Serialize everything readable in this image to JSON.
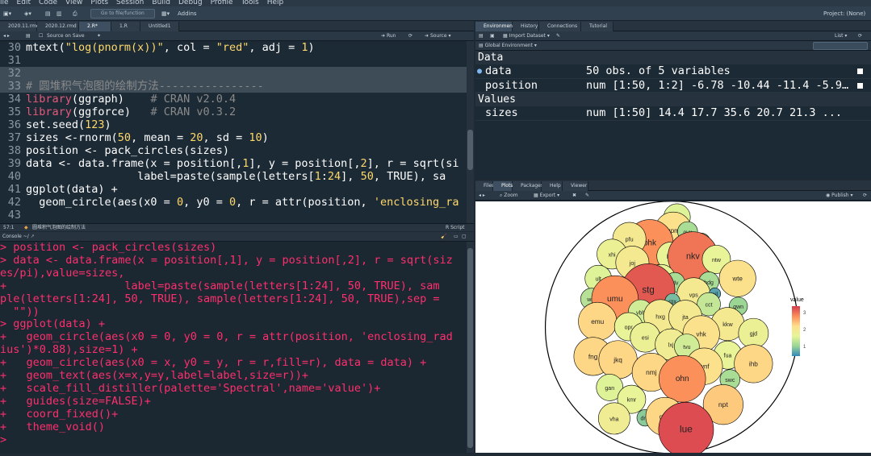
{
  "menu": [
    "ile",
    "Edit",
    "Code",
    "View",
    "Plots",
    "Session",
    "Build",
    "Debug",
    "Profile",
    "Tools",
    "Help"
  ],
  "toolbar": {
    "goto_placeholder": "Go to file/function",
    "addins": "Addins",
    "project": "Project: (None)"
  },
  "source_tabs": [
    "2020.11.rmd",
    "2020.12.rmd",
    "2.R*",
    "1.R",
    "Untitled1"
  ],
  "source_toolbar": {
    "source_on_save": "Source on Save",
    "run": "Run",
    "source": "Source"
  },
  "code_lines": [
    {
      "n": "30",
      "html": "mtext(<span class='str'>\"log(pnorm(x))\"</span>, col = <span class='str'>\"red\"</span>, adj = <span class='num'>1</span>)"
    },
    {
      "n": "31",
      "html": ""
    },
    {
      "n": "32",
      "html": "",
      "hl": true
    },
    {
      "n": "33",
      "html": "<span class='cmt'># 圆堆积气泡图的绘制方法----------------</span>",
      "hl": true
    },
    {
      "n": "34",
      "html": "<span class='kw'>library</span>(ggraph)    <span class='cmt'># CRAN v2.0.4</span>"
    },
    {
      "n": "35",
      "html": "<span class='kw'>library</span>(ggforce)   <span class='cmt'># CRAN v0.3.2</span>"
    },
    {
      "n": "36",
      "html": "set.seed(<span class='num'>123</span>)"
    },
    {
      "n": "37",
      "html": "sizes &lt;-rnorm(<span class='num'>50</span>, mean = <span class='num'>20</span>, sd = <span class='num'>10</span>)"
    },
    {
      "n": "38",
      "html": "position &lt;- pack_circles(sizes)"
    },
    {
      "n": "39",
      "html": "data &lt;- data.frame(x = position[,<span class='num'>1</span>], y = position[,<span class='num'>2</span>], r = sqrt(si"
    },
    {
      "n": "40",
      "html": "                 label=paste(sample(letters[<span class='num'>1</span>:<span class='num'>24</span>], <span class='num'>50</span>, TRUE), sa"
    },
    {
      "n": "41",
      "html": "ggplot(data) +"
    },
    {
      "n": "42",
      "html": "  geom_circle(aes(x0 = <span class='num'>0</span>, y0 = <span class='num'>0</span>, r = attr(position, <span class='str'>'enclosing_ra</span>"
    },
    {
      "n": "43",
      "html": ""
    }
  ],
  "status": {
    "pos": "57:1",
    "section": "圆堆积气泡图的绘制方法",
    "type": "R Script"
  },
  "console": {
    "title": "Console ~/",
    "lines": [
      "> position <- pack_circles(sizes)",
      "> data <- data.frame(x = position[,1], y = position[,2], r = sqrt(siz",
      "es/pi),value=sizes,",
      "+                  label=paste(sample(letters[1:24], 50, TRUE), sam",
      "ple(letters[1:24], 50, TRUE), sample(letters[1:24], 50, TRUE),sep =",
      "  \"\"))",
      "> ggplot(data) +",
      "+   geom_circle(aes(x0 = 0, y0 = 0, r = attr(position, 'enclosing_rad",
      "ius')*0.88),size=1) +",
      "+   geom_circle(aes(x0 = x, y0 = y, r = r,fill=r), data = data) +",
      "+   geom_text(aes(x=x,y=y,label=label,size=r))+",
      "+   scale_fill_distiller(palette='Spectral',name='value')+",
      "+   guides(size=FALSE)+",
      "+   coord_fixed()+",
      "+   theme_void()",
      ">"
    ]
  },
  "env_tabs": [
    "Environment",
    "History",
    "Connections",
    "Tutorial"
  ],
  "env_toolbar": {
    "import": "Import Dataset",
    "list": "List",
    "scope": "Global Environment"
  },
  "env": {
    "data_header": "Data",
    "values_header": "Values",
    "rows": [
      {
        "key": "data",
        "val": "50 obs. of 5 variables"
      },
      {
        "key": "position",
        "val": "num [1:50, 1:2] -6.78 -10.44 -11.4 -5.9…"
      },
      {
        "key": "sizes",
        "val": "num [1:50] 14.4 17.7 35.6 20.7 21.3 ..."
      }
    ]
  },
  "files_tabs": [
    "Files",
    "Plots",
    "Packages",
    "Help",
    "Viewer"
  ],
  "plots_toolbar": {
    "zoom": "Zoom",
    "export": "Export",
    "publish": "Publish"
  },
  "legend": {
    "title": "value",
    "ticks": [
      "3",
      "2",
      "1"
    ],
    "colors": [
      "#d53e4f",
      "#fc8d59",
      "#fee08b",
      "#e6f598",
      "#99d594",
      "#3288bd"
    ]
  },
  "chart_data": {
    "type": "scatter",
    "title": "",
    "bubbles": [
      {
        "label": "xqi",
        "x": 0.25,
        "y": 3.0,
        "v": 1.6
      },
      {
        "label": "qpm",
        "x": 0.0,
        "y": 2.0,
        "v": 2.2
      },
      {
        "label": "ovx",
        "x": 0.95,
        "y": 1.9,
        "v": 1.2
      },
      {
        "label": "bhk",
        "x": -1.55,
        "y": 1.05,
        "v": 2.8
      },
      {
        "label": "pfu",
        "x": -2.9,
        "y": 1.35,
        "v": 2.0
      },
      {
        "label": "sll",
        "x": 1.85,
        "y": 1.1,
        "v": 1.1
      },
      {
        "label": "xhi",
        "x": -4.05,
        "y": 0.2,
        "v": 1.8
      },
      {
        "label": "law",
        "x": -0.15,
        "y": 0.05,
        "v": 1.7
      },
      {
        "label": "nkv",
        "x": 1.3,
        "y": 0.0,
        "v": 3.0
      },
      {
        "label": "ntw",
        "x": 2.85,
        "y": -0.2,
        "v": 1.7
      },
      {
        "label": "joj",
        "x": -2.7,
        "y": -0.45,
        "v": 2.0
      },
      {
        "label": "ult",
        "x": -4.95,
        "y": -1.65,
        "v": 1.6
      },
      {
        "label": "dbl",
        "x": -0.8,
        "y": -1.65,
        "v": 1.7
      },
      {
        "label": "jdv",
        "x": 0.1,
        "y": -1.95,
        "v": 1.2
      },
      {
        "label": "hdg",
        "x": 2.35,
        "y": -1.9,
        "v": 1.2
      },
      {
        "label": "wte",
        "x": 4.25,
        "y": -1.65,
        "v": 2.2
      },
      {
        "label": "stg",
        "x": -1.65,
        "y": -2.55,
        "v": 3.2
      },
      {
        "label": "vps",
        "x": 1.35,
        "y": -2.85,
        "v": 2.0
      },
      {
        "label": "ajl",
        "x": 2.75,
        "y": -2.8,
        "v": 0.7
      },
      {
        "label": "wdf",
        "x": -5.4,
        "y": -3.2,
        "v": 1.3
      },
      {
        "label": "umu",
        "x": -3.85,
        "y": -3.2,
        "v": 2.8
      },
      {
        "label": "rgx",
        "x": -0.05,
        "y": -3.35,
        "v": 0.9
      },
      {
        "label": "cct",
        "x": 2.35,
        "y": -3.6,
        "v": 1.4
      },
      {
        "label": "gwn",
        "x": 4.3,
        "y": -3.75,
        "v": 1.1
      },
      {
        "label": "vbh",
        "x": -2.15,
        "y": -4.2,
        "v": 1.5
      },
      {
        "label": "hxg",
        "x": -0.85,
        "y": -4.5,
        "v": 2.0
      },
      {
        "label": "jta",
        "x": 0.8,
        "y": -4.55,
        "v": 2.0
      },
      {
        "label": "emu",
        "x": -5.0,
        "y": -4.9,
        "v": 2.3
      },
      {
        "label": "opr",
        "x": -2.95,
        "y": -5.3,
        "v": 1.7
      },
      {
        "label": "kkw",
        "x": 3.6,
        "y": -5.1,
        "v": 2.0
      },
      {
        "label": "vhk",
        "x": 1.85,
        "y": -5.85,
        "v": 2.2
      },
      {
        "label": "gjd",
        "x": 5.3,
        "y": -5.8,
        "v": 1.8
      },
      {
        "label": "esi",
        "x": -1.85,
        "y": -6.1,
        "v": 1.8
      },
      {
        "label": "lxj",
        "x": -0.15,
        "y": -6.65,
        "v": 1.9
      },
      {
        "label": "tvu",
        "x": 0.9,
        "y": -6.8,
        "v": 1.5
      },
      {
        "label": "fng",
        "x": -5.3,
        "y": -7.55,
        "v": 2.3
      },
      {
        "label": "jkq",
        "x": -3.65,
        "y": -7.8,
        "v": 2.3
      },
      {
        "label": "fua",
        "x": 3.6,
        "y": -7.45,
        "v": 1.7
      },
      {
        "label": "ihb",
        "x": 5.3,
        "y": -8.1,
        "v": 2.3
      },
      {
        "label": "wnf",
        "x": 2.05,
        "y": -8.3,
        "v": 2.2
      },
      {
        "label": "nmj",
        "x": -1.45,
        "y": -8.75,
        "v": 2.3
      },
      {
        "label": "ohn",
        "x": 0.6,
        "y": -9.25,
        "v": 2.8
      },
      {
        "label": "swc",
        "x": 3.75,
        "y": -9.3,
        "v": 1.2
      },
      {
        "label": "gan",
        "x": -4.2,
        "y": -9.9,
        "v": 1.6
      },
      {
        "label": "kmr",
        "x": -2.75,
        "y": -10.8,
        "v": 1.7
      },
      {
        "label": "npt",
        "x": 3.3,
        "y": -11.2,
        "v": 2.4
      },
      {
        "label": "dnq",
        "x": -1.85,
        "y": -12.2,
        "v": 1.0
      },
      {
        "label": "gbq",
        "x": -0.55,
        "y": -12.1,
        "v": 2.3
      },
      {
        "label": "vha",
        "x": -3.9,
        "y": -12.25,
        "v": 1.9
      },
      {
        "label": "lue",
        "x": 0.85,
        "y": -13.1,
        "v": 3.3
      }
    ],
    "enclosing": {
      "x": -0.1,
      "y": -5.35,
      "r": 8.35
    },
    "legend_title": "value",
    "legend_ticks": [
      1,
      2,
      3
    ],
    "xlim": [
      -7.2,
      7.2
    ],
    "ylim": [
      -14.3,
      3.7
    ]
  }
}
